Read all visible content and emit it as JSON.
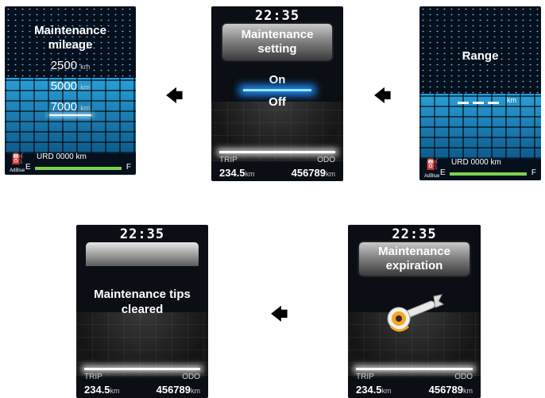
{
  "clock": "22:35",
  "trip": {
    "label": "TRIP",
    "value": "234.5",
    "unit": "km"
  },
  "odo": {
    "label": "ODO",
    "value": "456789",
    "unit": "km"
  },
  "fuel": {
    "urd_text": "URD 0000 km",
    "e": "E",
    "f": "F",
    "adblue": "AdBlue"
  },
  "screens": {
    "mileage": {
      "title_line1": "Maintenance",
      "title_line2": "mileage",
      "options": [
        {
          "value": "2500",
          "unit": "km"
        },
        {
          "value": "5000",
          "unit": "km"
        },
        {
          "value": "7000",
          "unit": "km"
        }
      ]
    },
    "setting": {
      "title_line1": "Maintenance",
      "title_line2": "setting",
      "option_on": "On",
      "option_off": "Off"
    },
    "range": {
      "title": "Range",
      "unit": "km"
    },
    "cleared": {
      "line1": "Maintenance tips",
      "line2": "cleared"
    },
    "expiration": {
      "title_line1": "Maintenance",
      "title_line2": "expiration"
    }
  },
  "icons": {
    "arrow": "arrow-left-icon",
    "wrench": "wrench-icon",
    "fuel": "fuel-pump-icon"
  }
}
